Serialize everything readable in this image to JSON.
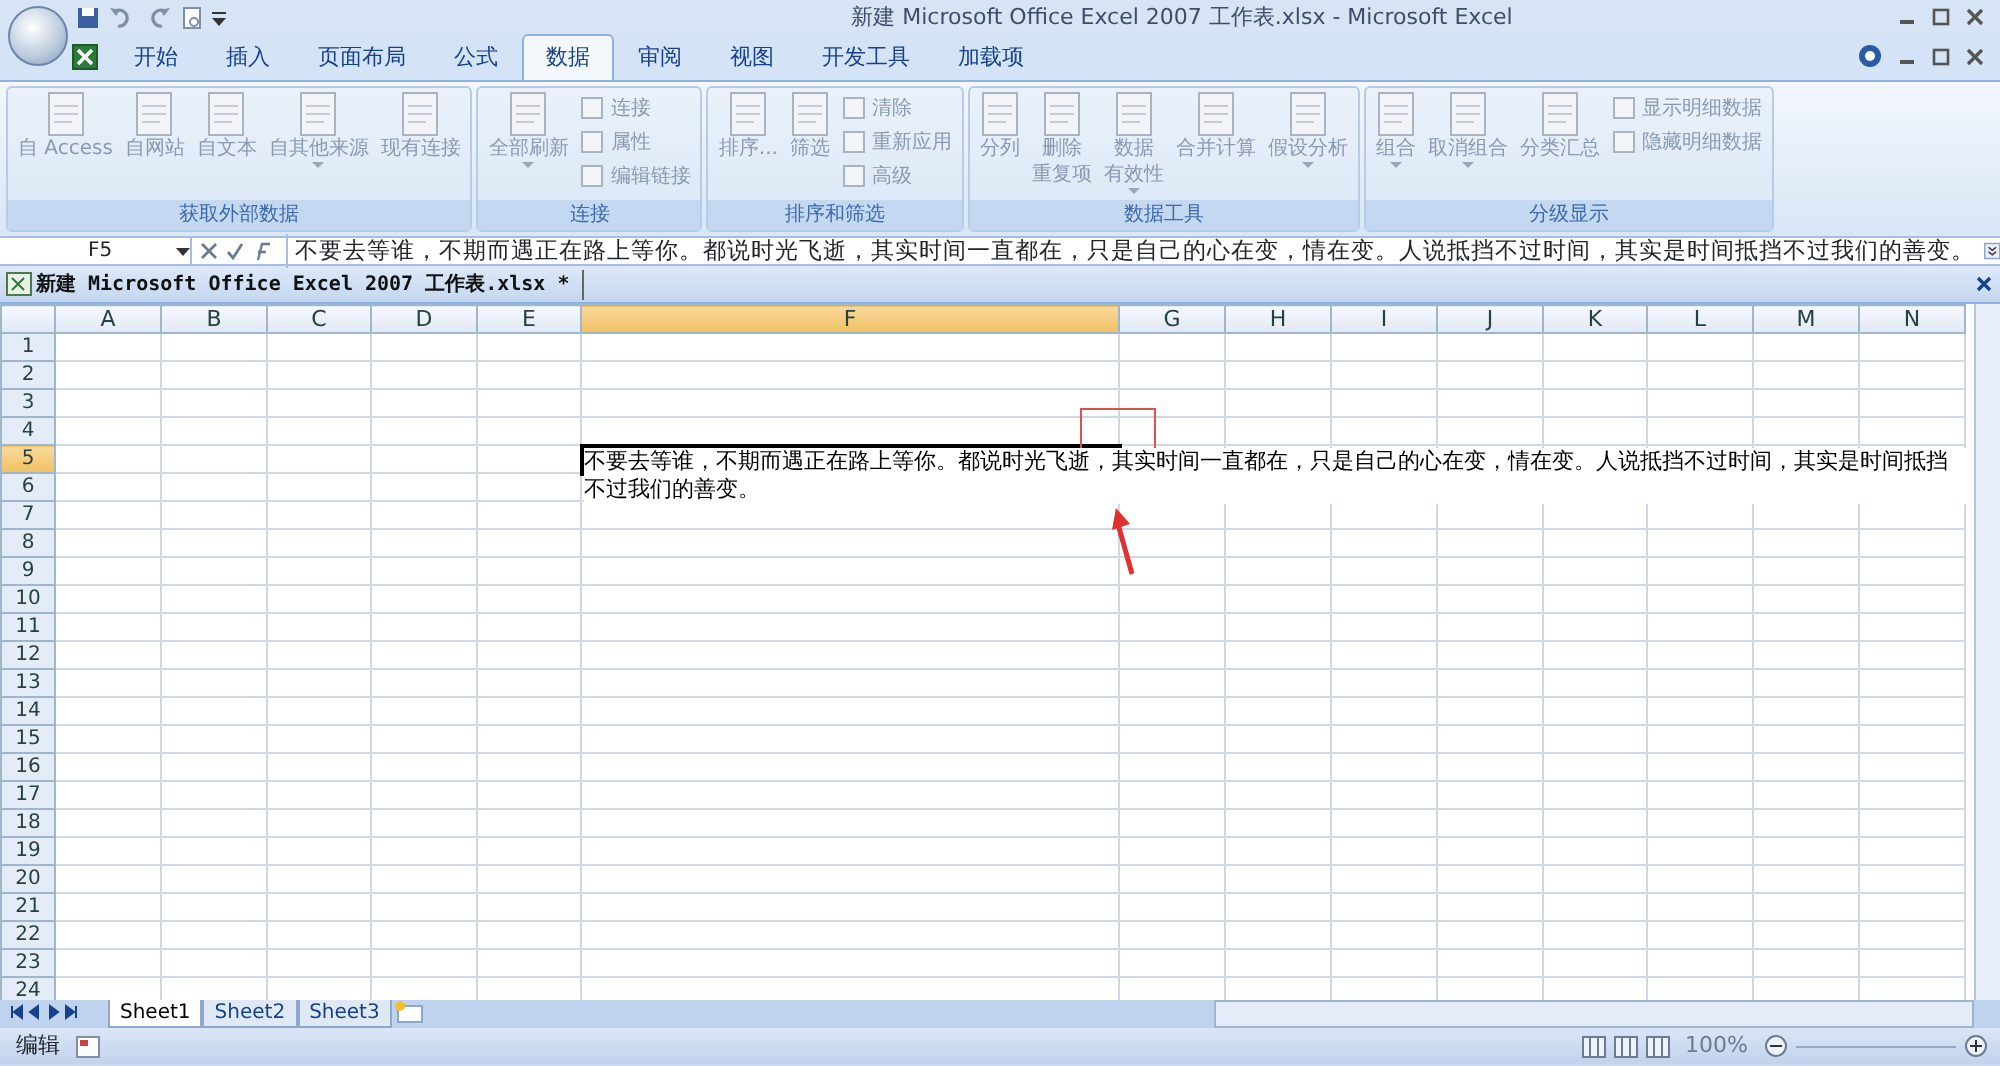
{
  "title_bar": {
    "title": "新建 Microsoft Office Excel 2007 工作表.xlsx - Microsoft Excel"
  },
  "ribbon": {
    "tabs": [
      {
        "label": "开始",
        "selected": false
      },
      {
        "label": "插入",
        "selected": false
      },
      {
        "label": "页面布局",
        "selected": false
      },
      {
        "label": "公式",
        "selected": false
      },
      {
        "label": "数据",
        "selected": true
      },
      {
        "label": "审阅",
        "selected": false
      },
      {
        "label": "视图",
        "selected": false
      },
      {
        "label": "开发工具",
        "selected": false
      },
      {
        "label": "加载项",
        "selected": false
      }
    ],
    "groups": [
      {
        "label": "获取外部数据",
        "commands": [
          {
            "kind": "large",
            "lines": [
              "自 Access"
            ],
            "dropdown": false
          },
          {
            "kind": "large",
            "lines": [
              "自网站"
            ],
            "dropdown": false
          },
          {
            "kind": "large",
            "lines": [
              "自文本"
            ],
            "dropdown": false
          },
          {
            "kind": "large",
            "lines": [
              "自其他来源"
            ],
            "dropdown": true
          },
          {
            "kind": "large",
            "lines": [
              "现有连接"
            ],
            "dropdown": false
          }
        ]
      },
      {
        "label": "连接",
        "commands": [
          {
            "kind": "large",
            "lines": [
              "全部刷新"
            ],
            "dropdown": true
          },
          {
            "kind": "small",
            "lines": [
              "连接"
            ],
            "dropdown": false
          },
          {
            "kind": "small",
            "lines": [
              "属性"
            ],
            "dropdown": false
          },
          {
            "kind": "small",
            "lines": [
              "编辑链接"
            ],
            "dropdown": false
          }
        ]
      },
      {
        "label": "排序和筛选",
        "commands": [
          {
            "kind": "large",
            "lines": [
              "排序..."
            ],
            "dropdown": false
          },
          {
            "kind": "large",
            "lines": [
              "筛选"
            ],
            "dropdown": false
          },
          {
            "kind": "small",
            "lines": [
              "清除"
            ],
            "dropdown": false
          },
          {
            "kind": "small",
            "lines": [
              "重新应用"
            ],
            "dropdown": false
          },
          {
            "kind": "small",
            "lines": [
              "高级"
            ],
            "dropdown": false
          }
        ]
      },
      {
        "label": "数据工具",
        "commands": [
          {
            "kind": "large",
            "lines": [
              "分列"
            ],
            "dropdown": false
          },
          {
            "kind": "large",
            "lines": [
              "删除",
              "重复项"
            ],
            "dropdown": false
          },
          {
            "kind": "large",
            "lines": [
              "数据",
              "有效性"
            ],
            "dropdown": true
          },
          {
            "kind": "large",
            "lines": [
              "合并计算"
            ],
            "dropdown": false
          },
          {
            "kind": "large",
            "lines": [
              "假设分析"
            ],
            "dropdown": true
          }
        ]
      },
      {
        "label": "分级显示",
        "commands": [
          {
            "kind": "large",
            "lines": [
              "组合"
            ],
            "dropdown": true
          },
          {
            "kind": "large",
            "lines": [
              "取消组合"
            ],
            "dropdown": true
          },
          {
            "kind": "large",
            "lines": [
              "分类汇总"
            ],
            "dropdown": false
          },
          {
            "kind": "small",
            "lines": [
              "显示明细数据"
            ],
            "dropdown": false
          },
          {
            "kind": "small",
            "lines": [
              "隐藏明细数据"
            ],
            "dropdown": false
          }
        ]
      }
    ]
  },
  "formula_bar": {
    "name_box": "F5",
    "content": "不要去等谁，不期而遇正在路上等你。都说时光飞逝，其实时间一直都在，只是自己的心在变，情在变。人说抵挡不过时间，其实是时间抵挡不过我们的善变。"
  },
  "workbook": {
    "title": "新建 Microsoft Office Excel 2007 工作表.xlsx *"
  },
  "sheet": {
    "columns": [
      {
        "label": "A",
        "selected": false
      },
      {
        "label": "B",
        "selected": false
      },
      {
        "label": "C",
        "selected": false
      },
      {
        "label": "D",
        "selected": false
      },
      {
        "label": "E",
        "selected": false
      },
      {
        "label": "F",
        "selected": true
      },
      {
        "label": "G",
        "selected": false
      },
      {
        "label": "H",
        "selected": false
      },
      {
        "label": "I",
        "selected": false
      },
      {
        "label": "J",
        "selected": false
      },
      {
        "label": "K",
        "selected": false
      },
      {
        "label": "L",
        "selected": false
      },
      {
        "label": "M",
        "selected": false
      },
      {
        "label": "N",
        "selected": false
      }
    ],
    "rows": [
      {
        "label": "1",
        "selected": false
      },
      {
        "label": "2",
        "selected": false
      },
      {
        "label": "3",
        "selected": false
      },
      {
        "label": "4",
        "selected": false
      },
      {
        "label": "5",
        "selected": true
      },
      {
        "label": "6",
        "selected": false
      },
      {
        "label": "7",
        "selected": false
      },
      {
        "label": "8",
        "selected": false
      },
      {
        "label": "9",
        "selected": false
      },
      {
        "label": "10",
        "selected": false
      },
      {
        "label": "11",
        "selected": false
      },
      {
        "label": "12",
        "selected": false
      },
      {
        "label": "13",
        "selected": false
      },
      {
        "label": "14",
        "selected": false
      },
      {
        "label": "15",
        "selected": false
      },
      {
        "label": "16",
        "selected": false
      },
      {
        "label": "17",
        "selected": false
      },
      {
        "label": "18",
        "selected": false
      },
      {
        "label": "19",
        "selected": false
      },
      {
        "label": "20",
        "selected": false
      },
      {
        "label": "21",
        "selected": false
      },
      {
        "label": "22",
        "selected": false
      },
      {
        "label": "23",
        "selected": false
      },
      {
        "label": "24",
        "selected": false
      }
    ],
    "cell_text": "不要去等谁，不期而遇正在路上等你。都说时光飞逝，其实时间一直都在，只是自己的心在变，情在变。人说抵挡不过时间，其实是时间抵挡不过我们的善变。"
  },
  "sheet_tabs": [
    {
      "label": "Sheet1",
      "selected": true
    },
    {
      "label": "Sheet2",
      "selected": false
    },
    {
      "label": "Sheet3",
      "selected": false
    }
  ],
  "status_bar": {
    "mode": "编辑",
    "zoom": "100%"
  }
}
